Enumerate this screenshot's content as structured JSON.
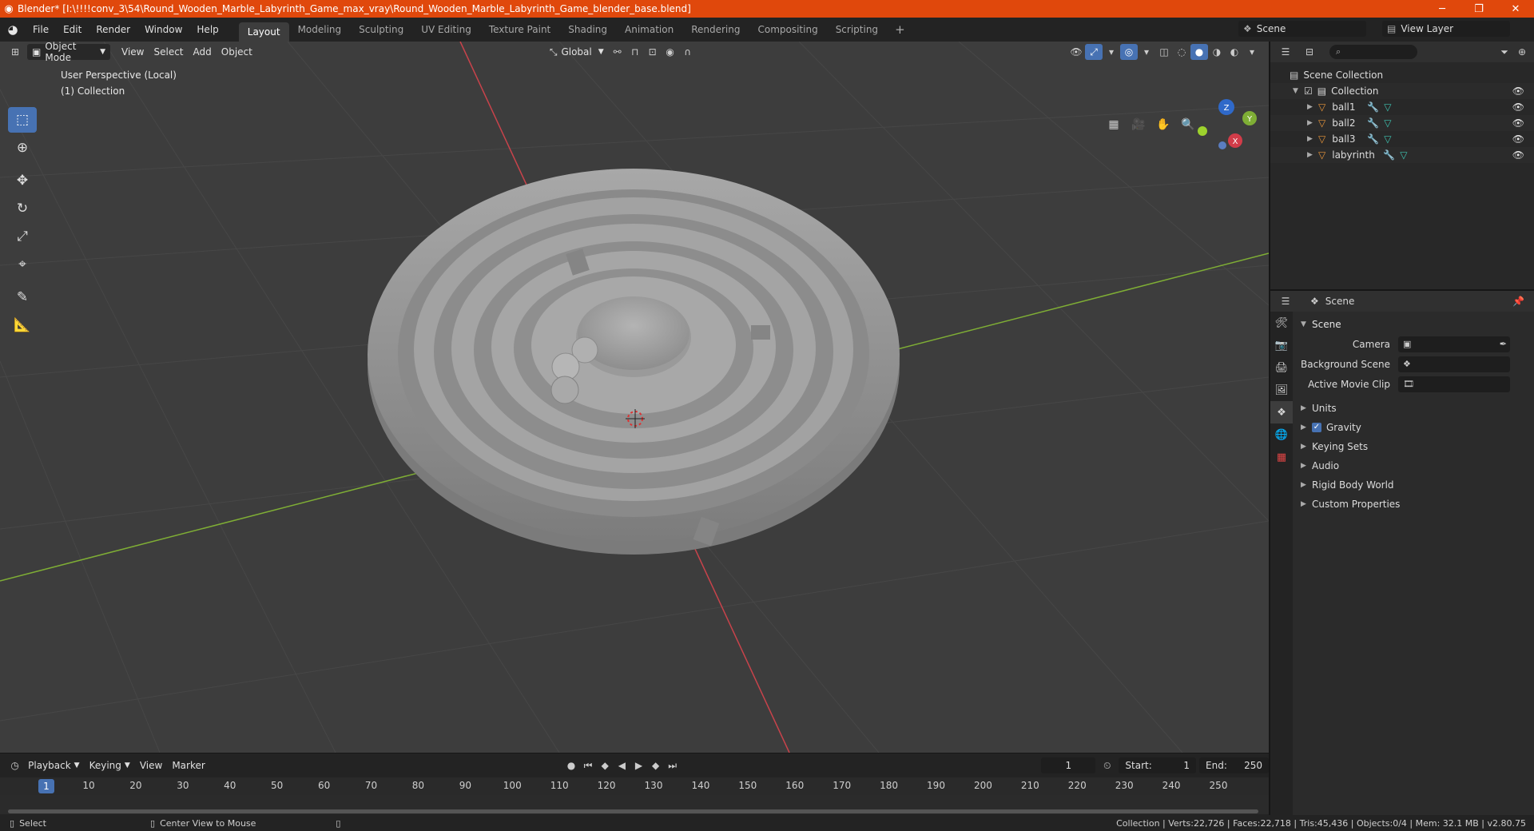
{
  "titlebar": {
    "title": "Blender* [I:\\!!!!conv_3\\54\\Round_Wooden_Marble_Labyrinth_Game_max_vray\\Round_Wooden_Marble_Labyrinth_Game_blender_base.blend]",
    "minimize": "─",
    "maximize": "❐",
    "close": "✕"
  },
  "menu": [
    "File",
    "Edit",
    "Render",
    "Window",
    "Help"
  ],
  "workspaces": [
    "Layout",
    "Modeling",
    "Sculpting",
    "UV Editing",
    "Texture Paint",
    "Shading",
    "Animation",
    "Rendering",
    "Compositing",
    "Scripting"
  ],
  "active_workspace": "Layout",
  "scene_name": "Scene",
  "view_layer": "View Layer",
  "viewport": {
    "mode": "Object Mode",
    "menus": [
      "View",
      "Select",
      "Add",
      "Object"
    ],
    "orientation": "Global",
    "info_line1": "User Perspective (Local)",
    "info_line2": "(1) Collection",
    "gizmo": {
      "x": "X",
      "y": "Y",
      "z": "Z"
    }
  },
  "outliner": {
    "root": "Scene Collection",
    "collection": "Collection",
    "objects": [
      "ball1",
      "ball2",
      "ball3",
      "labyrinth"
    ]
  },
  "properties": {
    "header": "Scene",
    "panel": "Scene",
    "fields": [
      {
        "label": "Camera",
        "value": ""
      },
      {
        "label": "Background Scene",
        "value": ""
      },
      {
        "label": "Active Movie Clip",
        "value": ""
      }
    ],
    "subpanels": [
      "Units",
      "Gravity",
      "Keying Sets",
      "Audio",
      "Rigid Body World",
      "Custom Properties"
    ],
    "gravity_checked": true
  },
  "timeline": {
    "menus": [
      "Playback",
      "Keying",
      "View",
      "Marker"
    ],
    "current_frame": "1",
    "start_label": "Start:",
    "start": "1",
    "end_label": "End:",
    "end": "250",
    "ticks": [
      "1",
      "10",
      "20",
      "30",
      "40",
      "50",
      "60",
      "70",
      "80",
      "90",
      "100",
      "110",
      "120",
      "130",
      "140",
      "150",
      "160",
      "170",
      "180",
      "190",
      "200",
      "210",
      "220",
      "230",
      "240",
      "250"
    ]
  },
  "status": {
    "left1": "Select",
    "left2": "Center View to Mouse",
    "right": "Collection | Verts:22,726 | Faces:22,718 | Tris:45,436 | Objects:0/4 | Mem: 32.1 MB | v2.80.75"
  },
  "colors": {
    "accent": "#4772b3",
    "titlebar": "#e0480c",
    "axis_x": "#c8434b",
    "axis_y": "#7fae35"
  }
}
